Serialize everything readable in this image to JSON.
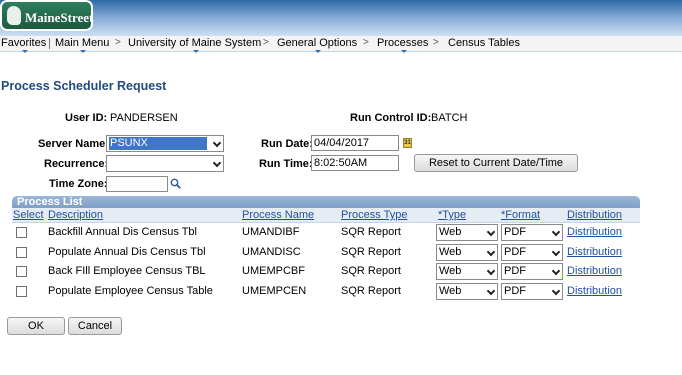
{
  "app": {
    "logo_text": "MaineStreet"
  },
  "nav": {
    "favorites": "Favorites",
    "main_menu": "Main Menu",
    "crumbs": [
      "University of Maine System",
      "General Options",
      "Processes",
      "Census Tables"
    ]
  },
  "page": {
    "title": "Process Scheduler Request",
    "user_id_label": "User ID:",
    "user_id_value": "PANDERSEN",
    "run_control_label": "Run Control ID:",
    "run_control_value": "BATCH",
    "server_name_label": "Server Name:",
    "server_name_value": "PSUNX",
    "recurrence_label": "Recurrence:",
    "recurrence_value": "",
    "time_zone_label": "Time Zone:",
    "time_zone_value": "",
    "run_date_label": "Run Date:",
    "run_date_value": "04/04/2017",
    "run_time_label": "Run Time:",
    "run_time_value": "8:02:50AM",
    "reset_button": "Reset to Current Date/Time",
    "calendar_icon_text": "31"
  },
  "process_list": {
    "title": "Process List",
    "columns": {
      "select": "Select",
      "description": "Description",
      "process_name": "Process Name",
      "process_type": "Process Type",
      "type": "*Type",
      "format": "*Format",
      "distribution": "Distribution"
    },
    "rows": [
      {
        "description": "Backfill Annual Dis Census Tbl",
        "process_name": "UMANDIBF",
        "process_type": "SQR Report",
        "type": "Web",
        "format": "PDF",
        "distribution": "Distribution"
      },
      {
        "description": "Populate Annual Dis Census Tbl",
        "process_name": "UMANDISC",
        "process_type": "SQR Report",
        "type": "Web",
        "format": "PDF",
        "distribution": "Distribution"
      },
      {
        "description": "Back FIll Employee Census TBL",
        "process_name": "UMEMPCBF",
        "process_type": "SQR Report",
        "type": "Web",
        "format": "PDF",
        "distribution": "Distribution"
      },
      {
        "description": "Populate Employee Census Table",
        "process_name": "UMEMPCEN",
        "process_type": "SQR Report",
        "type": "Web",
        "format": "PDF",
        "distribution": "Distribution"
      }
    ]
  },
  "buttons": {
    "ok": "OK",
    "cancel": "Cancel"
  }
}
